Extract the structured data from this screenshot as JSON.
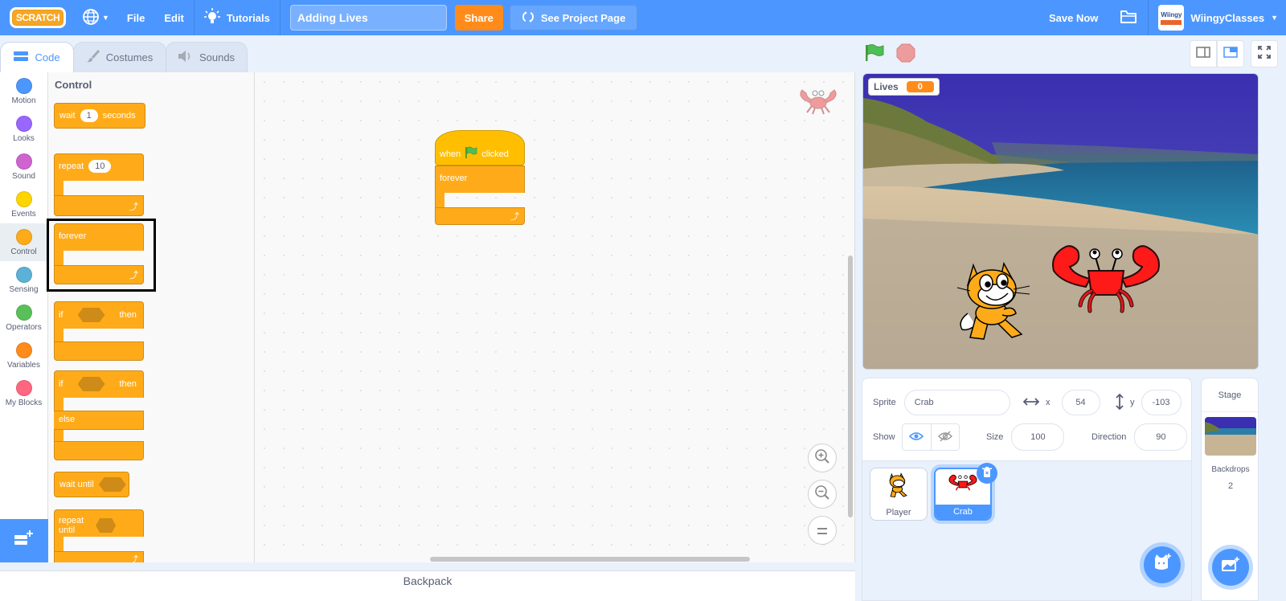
{
  "menubar": {
    "logo": "SCRATCH",
    "file": "File",
    "edit": "Edit",
    "tutorials": "Tutorials",
    "project_title": "Adding Lives",
    "share": "Share",
    "see_project_page": "See Project Page",
    "save_now": "Save Now",
    "username": "WiingyClasses",
    "avatar_text": "Wiingy"
  },
  "tabs": [
    {
      "label": "Code",
      "active": true
    },
    {
      "label": "Costumes",
      "active": false
    },
    {
      "label": "Sounds",
      "active": false
    }
  ],
  "categories": [
    {
      "label": "Motion",
      "color": "#4c97ff"
    },
    {
      "label": "Looks",
      "color": "#9966ff"
    },
    {
      "label": "Sound",
      "color": "#cf63cf"
    },
    {
      "label": "Events",
      "color": "#ffd500"
    },
    {
      "label": "Control",
      "color": "#ffab19",
      "active": true
    },
    {
      "label": "Sensing",
      "color": "#5cb1d6"
    },
    {
      "label": "Operators",
      "color": "#59c059"
    },
    {
      "label": "Variables",
      "color": "#ff8c1a"
    },
    {
      "label": "My Blocks",
      "color": "#ff6680"
    }
  ],
  "flyout": {
    "title": "Control",
    "wait": {
      "pre": "wait",
      "value": "1",
      "post": "seconds"
    },
    "repeat": {
      "pre": "repeat",
      "value": "10"
    },
    "forever": "forever",
    "if_then": {
      "if": "if",
      "then": "then"
    },
    "if_else": {
      "if": "if",
      "then": "then",
      "else": "else"
    },
    "wait_until": "wait until",
    "repeat_until": "repeat until"
  },
  "script": {
    "hat": {
      "pre": "when",
      "post": "clicked"
    },
    "forever": "forever"
  },
  "workspace": {
    "backpack": "Backpack"
  },
  "stage": {
    "monitor_label": "Lives",
    "monitor_value": "0"
  },
  "sprite_info": {
    "sprite_label": "Sprite",
    "sprite_name": "Crab",
    "x_label": "x",
    "x_value": "54",
    "y_label": "y",
    "y_value": "-103",
    "show_label": "Show",
    "size_label": "Size",
    "size_value": "100",
    "direction_label": "Direction",
    "direction_value": "90"
  },
  "sprites": [
    {
      "name": "Player",
      "selected": false
    },
    {
      "name": "Crab",
      "selected": true
    }
  ],
  "stage_pane": {
    "title": "Stage",
    "backdrops_label": "Backdrops",
    "backdrops_count": "2"
  }
}
